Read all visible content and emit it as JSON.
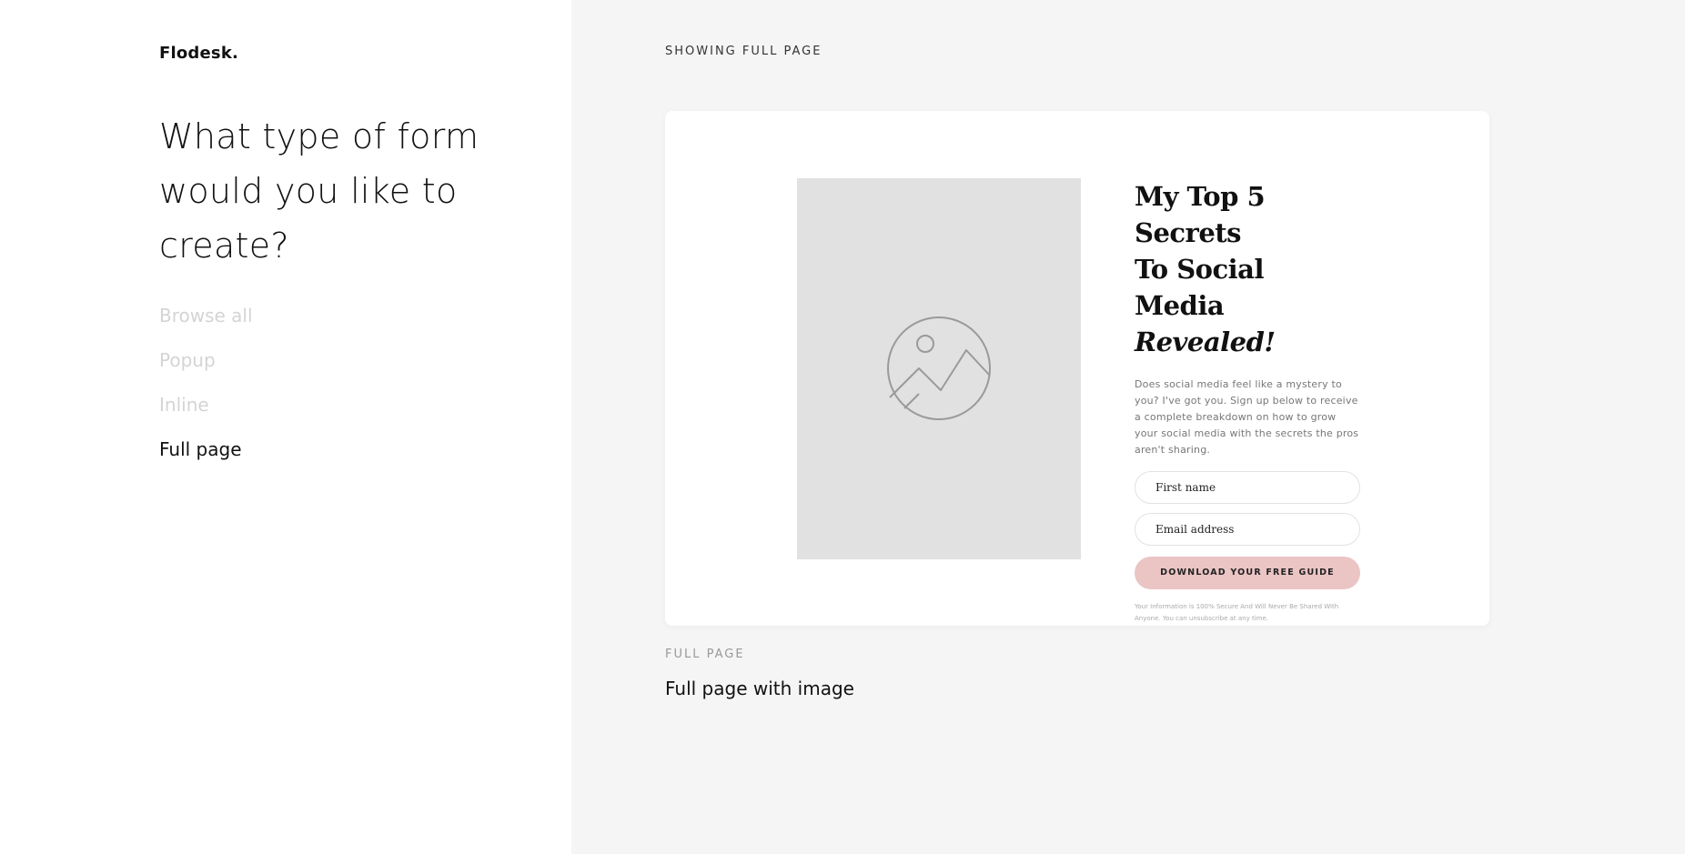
{
  "brand": {
    "logo_text": "Flodesk."
  },
  "sidebar": {
    "heading": "What type of form would you like to create?",
    "menu": [
      {
        "label": "Browse all",
        "active": false
      },
      {
        "label": "Popup",
        "active": false
      },
      {
        "label": "Inline",
        "active": false
      },
      {
        "label": "Full page",
        "active": true
      }
    ]
  },
  "main": {
    "showing_label": "SHOWING FULL PAGE",
    "template": {
      "title_line1": "My Top 5 Secrets",
      "title_line2": "To Social Media",
      "title_italic": "Revealed!",
      "description": "Does social media feel like a mystery to you? I've got you. Sign up below to receive a complete breakdown on how to grow your social media with the secrets the pros aren't sharing.",
      "first_name_placeholder": "First name",
      "email_placeholder": "Email address",
      "cta_label": "DOWNLOAD YOUR FREE GUIDE",
      "fineprint": "Your Information is 100% Secure And Will Never Be Shared With Anyone. You can unsubscribe at any time.",
      "image_icon": "image-placeholder-icon"
    },
    "card_type": "FULL PAGE",
    "card_name": "Full page with image"
  },
  "colors": {
    "cta_background": "#ebc4c4",
    "main_background": "#f5f5f5",
    "image_placeholder": "#e1e1e1",
    "inactive_menu": "#d4d4d4"
  }
}
